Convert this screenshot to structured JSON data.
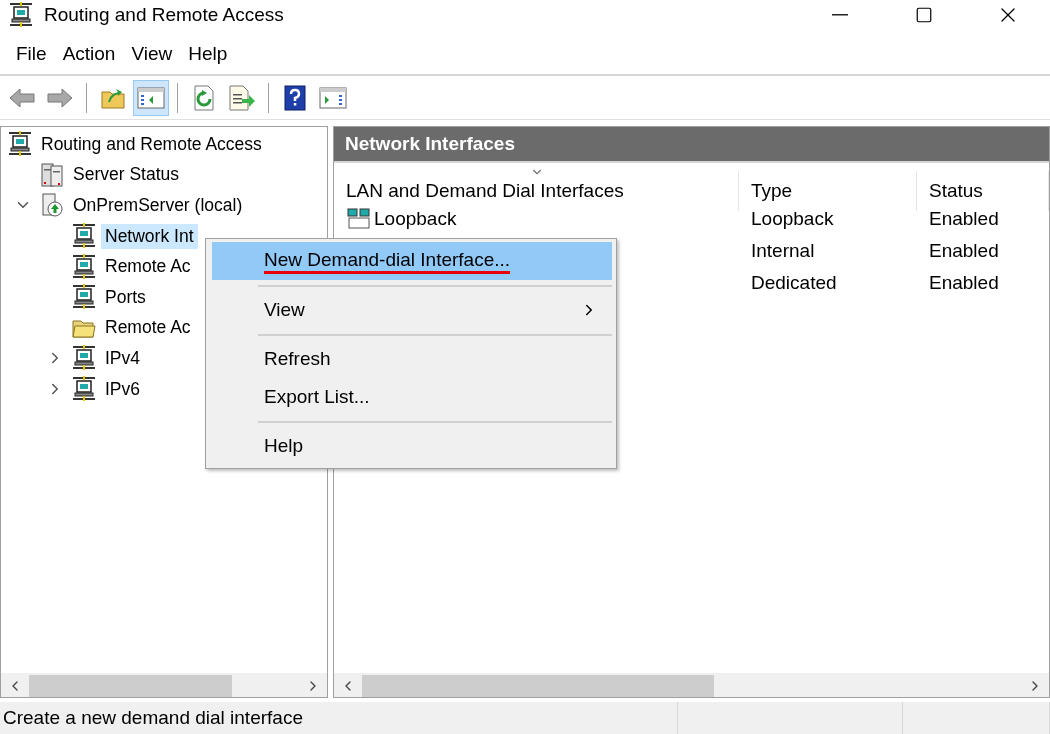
{
  "window": {
    "title": "Routing and Remote Access"
  },
  "menu_bar": [
    "File",
    "Action",
    "View",
    "Help"
  ],
  "toolbar": [
    {
      "kind": "back",
      "pressed": false
    },
    {
      "kind": "forward",
      "pressed": false
    },
    {
      "kind": "sep"
    },
    {
      "kind": "up",
      "pressed": false
    },
    {
      "kind": "tree",
      "pressed": true
    },
    {
      "kind": "sep"
    },
    {
      "kind": "refresh",
      "pressed": false
    },
    {
      "kind": "export",
      "pressed": false
    },
    {
      "kind": "sep"
    },
    {
      "kind": "help",
      "pressed": false
    },
    {
      "kind": "action",
      "pressed": false
    }
  ],
  "tree": [
    {
      "label": "Routing and Remote Access",
      "kind": "network",
      "selected": false,
      "children": [
        {
          "label": "Server Status",
          "kind": "server",
          "selected": false
        },
        {
          "label": "OnPremServer (local)",
          "kind": "local",
          "selected": false,
          "expanded": true,
          "children": [
            {
              "label": "Network Int",
              "kind": "network",
              "selected": true
            },
            {
              "label": "Remote Ac",
              "kind": "network",
              "selected": false
            },
            {
              "label": "Ports",
              "kind": "network",
              "selected": false
            },
            {
              "label": "Remote Ac",
              "kind": "folder",
              "selected": false
            },
            {
              "label": "IPv4",
              "kind": "network",
              "selected": false,
              "expanded": false
            },
            {
              "label": "IPv6",
              "kind": "network",
              "selected": false,
              "expanded": false
            }
          ]
        }
      ]
    }
  ],
  "details": {
    "title": "Network Interfaces",
    "columns": [
      "LAN and Demand Dial Interfaces",
      "Type",
      "Status"
    ],
    "rows": [
      {
        "name": "Loopback",
        "type": "Loopback",
        "status": "Enabled"
      },
      {
        "type": "Internal",
        "status": "Enabled"
      },
      {
        "type": "Dedicated",
        "status": "Enabled"
      }
    ]
  },
  "context_menu": [
    {
      "kind": "item",
      "label": "New Demand-dial Interface...",
      "selected": true,
      "annotated": true
    },
    {
      "kind": "separator"
    },
    {
      "kind": "submenu",
      "label": "View",
      "selected": false
    },
    {
      "kind": "separator"
    },
    {
      "kind": "item",
      "label": "Refresh",
      "selected": false
    },
    {
      "kind": "item",
      "label": "Export List...",
      "selected": false
    },
    {
      "kind": "separator"
    },
    {
      "kind": "item",
      "label": "Help",
      "selected": false
    }
  ],
  "status_bar": "Create a new demand dial interface"
}
